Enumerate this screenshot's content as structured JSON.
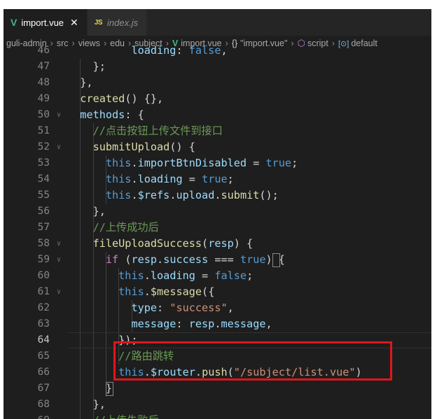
{
  "tabs": [
    {
      "icon": "V",
      "label": "import.vue",
      "close": "✕",
      "active": true
    },
    {
      "icon": "JS",
      "label": "index.js",
      "active": false
    }
  ],
  "breadcrumb": [
    "guli-admin",
    "src",
    "views",
    "edu",
    "subject",
    "import.vue",
    "\"import.vue\"",
    "script",
    "default"
  ],
  "editor": {
    "current_line": 64,
    "lines": [
      {
        "n": 46,
        "code": "          loading: false,"
      },
      {
        "n": 47,
        "code": "    };"
      },
      {
        "n": 48,
        "code": "  },"
      },
      {
        "n": 49,
        "code": "  created() {},"
      },
      {
        "n": 50,
        "code": "  methods: {"
      },
      {
        "n": 51,
        "code": "    //点击按钮上传文件到接口"
      },
      {
        "n": 52,
        "code": "    submitUpload() {"
      },
      {
        "n": 53,
        "code": "      this.importBtnDisabled = true;"
      },
      {
        "n": 54,
        "code": "      this.loading = true;"
      },
      {
        "n": 55,
        "code": "      this.$refs.upload.submit();"
      },
      {
        "n": 56,
        "code": "    },"
      },
      {
        "n": 57,
        "code": "    //上传成功后"
      },
      {
        "n": 58,
        "code": "    fileUploadSuccess(resp) {"
      },
      {
        "n": 59,
        "code": "      if (resp.success === true) {"
      },
      {
        "n": 60,
        "code": "        this.loading = false;"
      },
      {
        "n": 61,
        "code": "        this.$message({"
      },
      {
        "n": 62,
        "code": "          type: \"success\","
      },
      {
        "n": 63,
        "code": "          message: resp.message,"
      },
      {
        "n": 64,
        "code": "        });"
      },
      {
        "n": 65,
        "code": "        //路由跳转"
      },
      {
        "n": 66,
        "code": "        this.$router.push(\"/subject/list.vue\")"
      },
      {
        "n": 67,
        "code": "      }"
      },
      {
        "n": 68,
        "code": "    },"
      },
      {
        "n": 69,
        "code": "    //上传失败后"
      }
    ]
  },
  "colors": {
    "highlight_box": "#e0161c",
    "vue_icon": "#41b883",
    "js_icon": "#e8d44d"
  }
}
